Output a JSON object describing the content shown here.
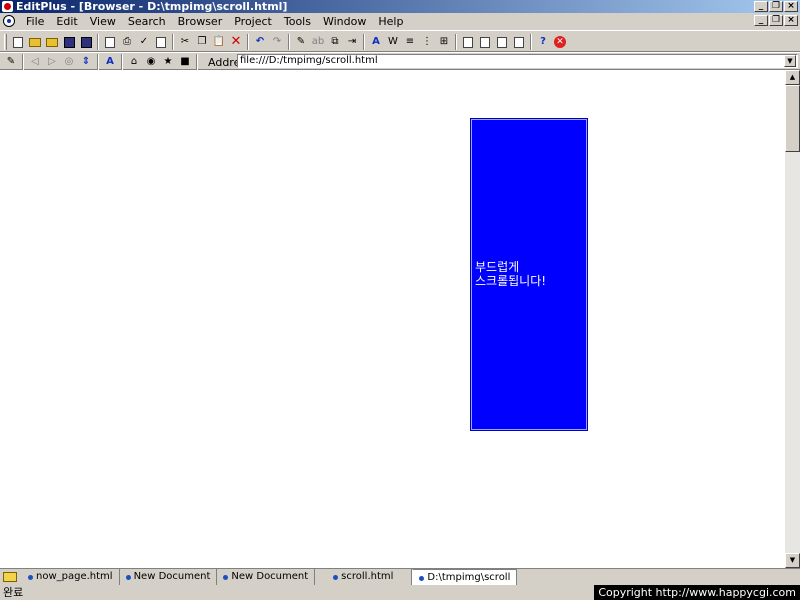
{
  "window": {
    "title": "EditPlus - [Browser - D:\\tmpimg\\scroll.html]",
    "controls": {
      "minimize": "_",
      "restore": "❐",
      "close": "×"
    }
  },
  "menu": {
    "items": [
      "File",
      "Edit",
      "View",
      "Search",
      "Browser",
      "Project",
      "Tools",
      "Window",
      "Help"
    ]
  },
  "browser_toolbar": {
    "address_label": "Address",
    "address_value": "file:///D:/tmpimg/scroll.html"
  },
  "content": {
    "box_text": "부드럽게\n스크롤됩니다!",
    "box_color": "#0000ff"
  },
  "tabs": [
    {
      "label": "now_page.html",
      "active": false
    },
    {
      "label": "New Document",
      "active": false
    },
    {
      "label": "New Document",
      "active": false
    },
    {
      "label": "scroll.html",
      "active": false
    },
    {
      "label": "D:\\tmpimg\\scroll",
      "active": true
    }
  ],
  "status": {
    "left": "완료",
    "right": "Copyright  http://www.happycgi.com"
  }
}
